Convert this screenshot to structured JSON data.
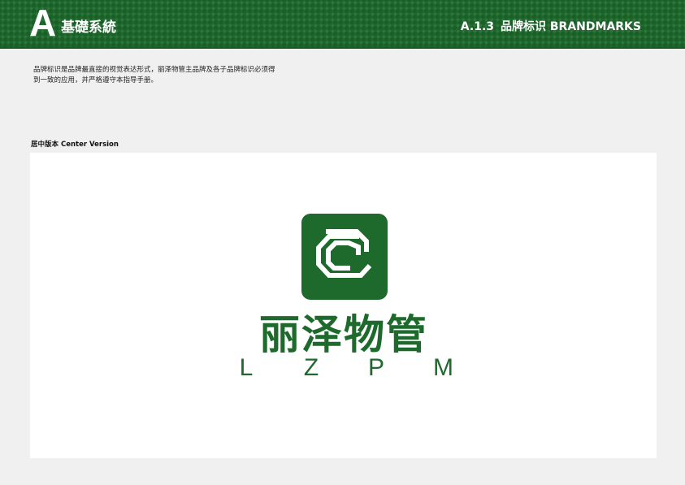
{
  "header": {
    "letter": "A",
    "category": "基礎系統",
    "section_code": "A.1.3",
    "section_name_cn": "品牌标识",
    "section_name_en": "BRANDMARKS"
  },
  "intro": {
    "line1": "品牌标识是品牌最直接的视觉表达形式，丽泽物管主品牌及各子品牌标识必须得",
    "line2": "到一致的应用，并严格遵守本指导手册。"
  },
  "version_label": "居中版本 Center Version",
  "logo": {
    "name_cn": "丽泽物管",
    "letters": [
      "L",
      "Z",
      "P",
      "M"
    ],
    "brand_color": "#1e6a2d"
  }
}
